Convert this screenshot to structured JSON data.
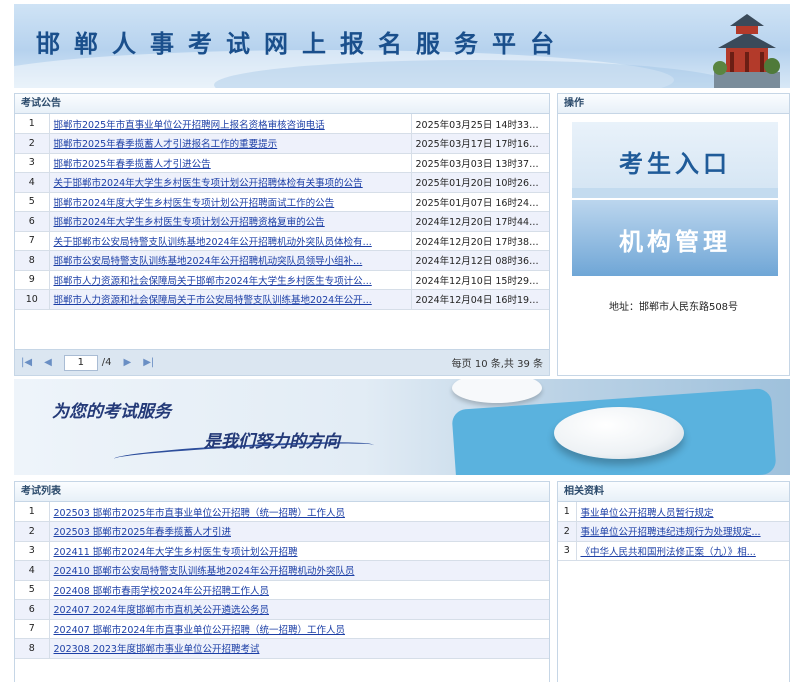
{
  "header": {
    "title": "邯郸人事考试网上报名服务平台"
  },
  "announcements": {
    "title": "考试公告",
    "rows": [
      {
        "num": "1",
        "title": "邯郸市2025年市直事业单位公开招聘网上报名资格审核咨询电话",
        "date": "2025年03月25日 14时33分..."
      },
      {
        "num": "2",
        "title": "邯郸市2025年春季揽蓄人才引进报名工作的重要提示",
        "date": "2025年03月17日 17时16分..."
      },
      {
        "num": "3",
        "title": "邯郸市2025年春季揽蓄人才引进公告",
        "date": "2025年03月03日 13时37分..."
      },
      {
        "num": "4",
        "title": "关于邯郸市2024年大学生乡村医生专项计划公开招聘体检有关事项的公告",
        "date": "2025年01月20日 10时26分..."
      },
      {
        "num": "5",
        "title": "邯郸市2024年度大学生乡村医生专项计划公开招聘面试工作的公告",
        "date": "2025年01月07日 16时24分..."
      },
      {
        "num": "6",
        "title": "邯郸市2024年大学生乡村医生专项计划公开招聘资格复审的公告",
        "date": "2024年12月20日 17时44分..."
      },
      {
        "num": "7",
        "title": "关于邯郸市公安局特警支队训练基地2024年公开招聘机动外突队员体检有...",
        "date": "2024年12月20日 17时38分..."
      },
      {
        "num": "8",
        "title": "邯郸市公安局特警支队训练基地2024年公开招聘机动突队员领导小组补...",
        "date": "2024年12月12日 08时36分..."
      },
      {
        "num": "9",
        "title": "邯郸市人力资源和社会保障局关于邯郸市2024年大学生乡村医生专项计公...",
        "date": "2024年12月10日 15时29分..."
      },
      {
        "num": "10",
        "title": "邯郸市人力资源和社会保障局关于市公安局特警支队训练基地2024年公开...",
        "date": "2024年12月04日 16时19分..."
      }
    ],
    "pager": {
      "first": "|◀",
      "prev": "◀",
      "page": "1",
      "total": "/4",
      "next": "▶",
      "last": "▶|",
      "info": "每页 10 条,共 39 条"
    }
  },
  "actions": {
    "title": "操作",
    "candidate_entry": "考生入口",
    "org_manage": "机构管理",
    "address": "地址：邯郸市人民东路508号"
  },
  "banner": {
    "slogan1": "为您的考试服务",
    "slogan2": "是我们努力的方向"
  },
  "exams": {
    "title": "考试列表",
    "rows": [
      {
        "num": "1",
        "title": "202503 邯郸市2025年市直事业单位公开招聘（统一招聘）工作人员"
      },
      {
        "num": "2",
        "title": "202503 邯郸市2025年春季揽蓄人才引进"
      },
      {
        "num": "3",
        "title": "202411 邯郸市2024年大学生乡村医生专项计划公开招聘"
      },
      {
        "num": "4",
        "title": "202410 邯郸市公安局特警支队训练基地2024年公开招聘机动外突队员"
      },
      {
        "num": "5",
        "title": "202408 邯郸市春雨学校2024年公开招聘工作人员"
      },
      {
        "num": "6",
        "title": "202407 2024年度邯郸市市直机关公开遴选公务员"
      },
      {
        "num": "7",
        "title": "202407 邯郸市2024年市直事业单位公开招聘（统一招聘）工作人员"
      },
      {
        "num": "8",
        "title": "202308 2023年度邯郸市事业单位公开招聘考试"
      }
    ]
  },
  "resources": {
    "title": "相关资料",
    "rows": [
      {
        "num": "1",
        "title": "事业单位公开招聘人员暂行规定"
      },
      {
        "num": "2",
        "title": "事业单位公开招聘违纪违规行为处理规定..."
      },
      {
        "num": "3",
        "title": "《中华人民共和国刑法修正案（九）》相..."
      }
    ]
  }
}
